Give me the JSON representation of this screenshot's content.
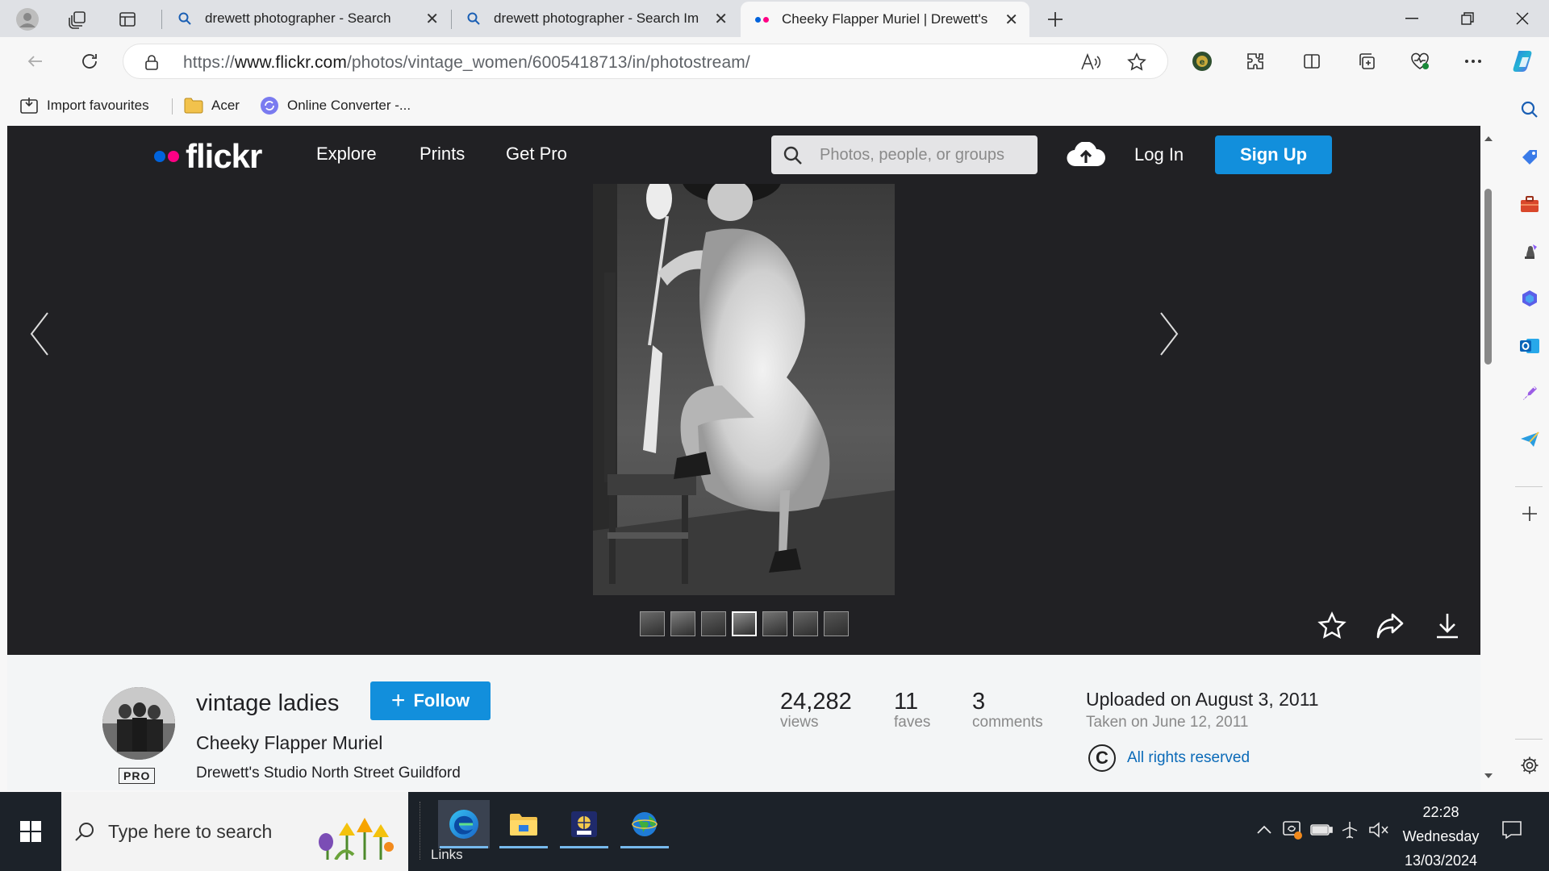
{
  "browser": {
    "tabs": [
      {
        "title": "drewett photographer - Search",
        "active": false
      },
      {
        "title": "drewett photographer - Search Im",
        "active": false
      },
      {
        "title": "Cheeky Flapper Muriel | Drewett's",
        "active": true
      }
    ],
    "url_prefix": "https://",
    "url_host": "www.flickr.com",
    "url_path": "/photos/vintage_women/6005418713/in/photostream/",
    "favourites": [
      {
        "label": "Import favourites",
        "icon": "import-favourites-icon"
      },
      {
        "label": "Acer",
        "icon": "folder-icon"
      },
      {
        "label": "Online Converter -...",
        "icon": "converter-icon"
      }
    ]
  },
  "flickr": {
    "logo_text": "flickr",
    "nav": [
      "Explore",
      "Prints",
      "Get Pro"
    ],
    "search_placeholder": "Photos, people, or groups",
    "login_label": "Log In",
    "signup_label": "Sign Up",
    "owner_name": "vintage ladies",
    "pro_badge": "PRO",
    "follow_label": "Follow",
    "photo_title": "Cheeky Flapper Muriel",
    "photo_description": "Drewett's Studio North Street Guildford",
    "stats": [
      {
        "value": "24,282",
        "label": "views"
      },
      {
        "value": "11",
        "label": "faves"
      },
      {
        "value": "3",
        "label": "comments"
      }
    ],
    "uploaded": "Uploaded on August 3, 2011",
    "taken": "Taken on June 12, 2011",
    "rights": "All rights reserved",
    "copyright_symbol": "C",
    "thumbnail_count": 7,
    "current_thumbnail_index": 3,
    "colors": {
      "header_bg": "#212124",
      "blue": "#128fdc",
      "pink": "#ff0084",
      "dot_blue": "#0063dc"
    }
  },
  "taskbar": {
    "search_placeholder": "Type here to search",
    "links_label": "Links",
    "time": "22:28",
    "day": "Wednesday",
    "date": "13/03/2024"
  }
}
